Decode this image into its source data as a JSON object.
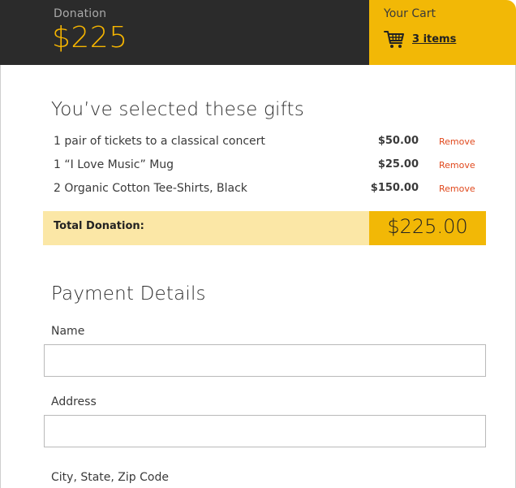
{
  "header": {
    "donation_label": "Donation",
    "donation_amount": "$225",
    "cart_label": "Your Cart",
    "cart_icon": "shopping-cart-icon",
    "cart_count": "3 items"
  },
  "colors": {
    "dark_bg": "#2b2b2b",
    "accent": "#f2b806",
    "accent_text": "#f5b400",
    "total_light": "#fbe7a6",
    "remove_link": "#e0481c"
  },
  "gifts": {
    "title": "You’ve selected these gifts",
    "items": [
      {
        "description": "1 pair of tickets to a classical concert",
        "price": "$50.00",
        "remove_label": "Remove"
      },
      {
        "description": "1 “I Love Music” Mug",
        "price": "$25.00",
        "remove_label": "Remove"
      },
      {
        "description": "2 Organic Cotton Tee-Shirts, Black",
        "price": "$150.00",
        "remove_label": "Remove"
      }
    ],
    "total_label": "Total Donation:",
    "total_value": "$225.00"
  },
  "payment": {
    "title": "Payment Details",
    "name_label": "Name",
    "name_value": "",
    "address_label": "Address",
    "address_value": "",
    "city_label": "City, State, Zip Code"
  }
}
